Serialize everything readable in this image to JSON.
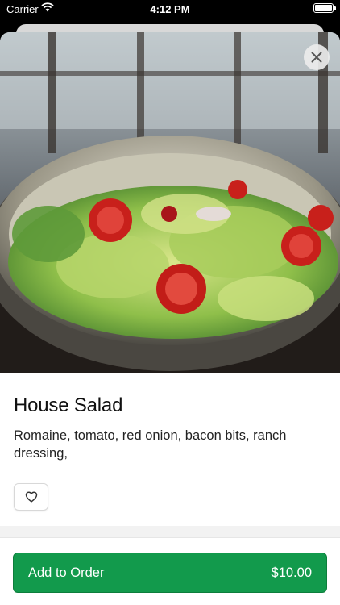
{
  "status_bar": {
    "carrier": "Carrier",
    "time": "4:12 PM"
  },
  "item": {
    "title": "House Salad",
    "description": "Romaine, tomato, red onion, bacon bits, ranch dressing,"
  },
  "footer": {
    "add_label": "Add to Order",
    "price": "$10.00"
  },
  "colors": {
    "accent": "#129a4c"
  },
  "icons": {
    "close": "close-icon",
    "favorite": "heart-icon"
  }
}
